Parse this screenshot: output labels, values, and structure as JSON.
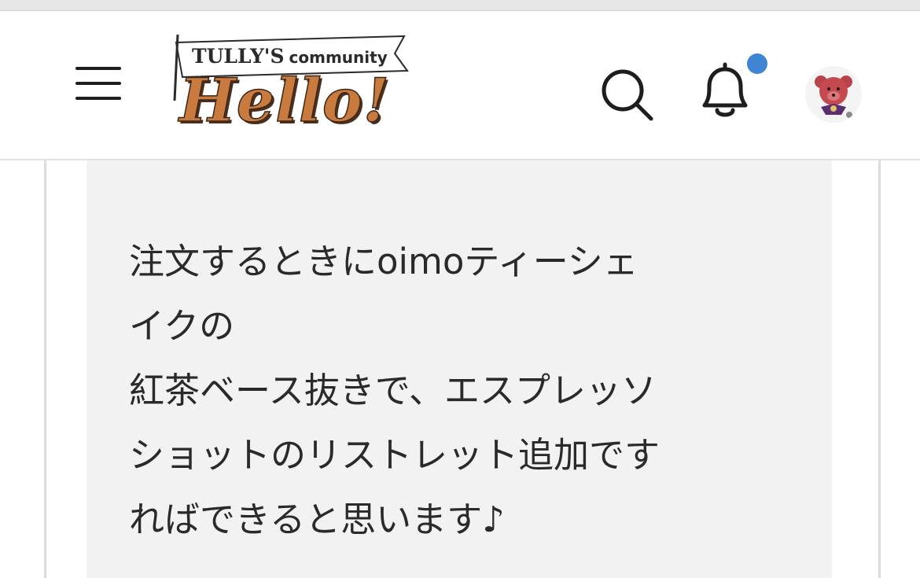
{
  "header": {
    "logo": {
      "brand": "TULLY'S",
      "community": "community",
      "title": "Hello!"
    },
    "menu_icon": "hamburger-menu-icon",
    "search_icon": "search-icon",
    "notification_icon": "bell-icon",
    "notification_dot_color": "#3f85d4",
    "avatar": "teddy-bear-avatar"
  },
  "post": {
    "lines": [
      "注文するときにoimoティーシェ",
      "イクの",
      "紅茶ベース抜きで、エスプレッソ",
      "ショットのリストレット追加です",
      "ればできると思います♪"
    ]
  },
  "colors": {
    "logo_orange": "#c97a3f",
    "quote_background": "#f3f2f3"
  }
}
